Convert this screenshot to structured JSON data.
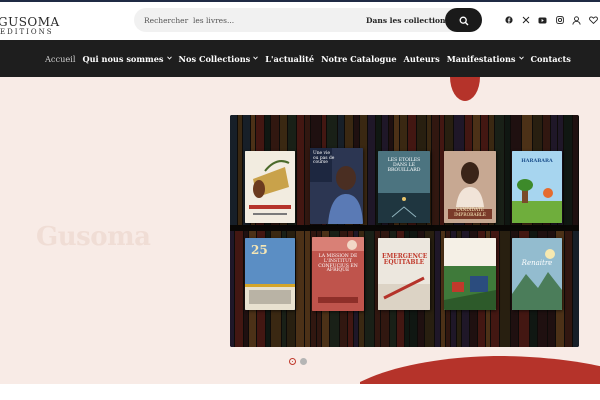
{
  "brand": {
    "logo_main": "GUSOMA",
    "logo_sub": "EDITIONS"
  },
  "search": {
    "placeholder": "Rechercher  les livres...",
    "scope_label": "Dans les collections"
  },
  "header_icons": [
    "facebook-icon",
    "x-icon",
    "youtube-icon",
    "instagram-icon",
    "user-icon",
    "heart-icon"
  ],
  "nav": {
    "items": [
      {
        "label": "Accueil",
        "active": true,
        "dropdown": false
      },
      {
        "label": "Qui nous sommes",
        "active": false,
        "dropdown": true
      },
      {
        "label": "Nos Collections",
        "active": false,
        "dropdown": true
      },
      {
        "label": "L'actualité",
        "active": false,
        "dropdown": false
      },
      {
        "label": "Notre Catalogue",
        "active": false,
        "dropdown": false
      },
      {
        "label": "Auteurs",
        "active": false,
        "dropdown": false
      },
      {
        "label": "Manifestations",
        "active": false,
        "dropdown": true
      },
      {
        "label": "Contacts",
        "active": false,
        "dropdown": false
      }
    ]
  },
  "hero": {
    "watermark": "Gusoma",
    "books": [
      {
        "title": ""
      },
      {
        "title": "Une vie ou pas de course"
      },
      {
        "title": "LES ETOILES DANS LE BROUILLARD"
      },
      {
        "title": "CANDIDATE IMPROBABLE"
      },
      {
        "title": "HARABARA"
      },
      {
        "title": "25"
      },
      {
        "title": "LA MISSION DE L'INSTITUT CONFUCIUS EN AFRIQUE"
      },
      {
        "title": "EMERGENCE EQUITABLE"
      },
      {
        "title": ""
      },
      {
        "title": "Renaitre"
      }
    ],
    "slides": {
      "count": 2,
      "active": 1
    }
  },
  "colors": {
    "accent": "#c0392b",
    "nav_bg": "#1e1e1e",
    "hero_bg": "#f8ebe6"
  }
}
